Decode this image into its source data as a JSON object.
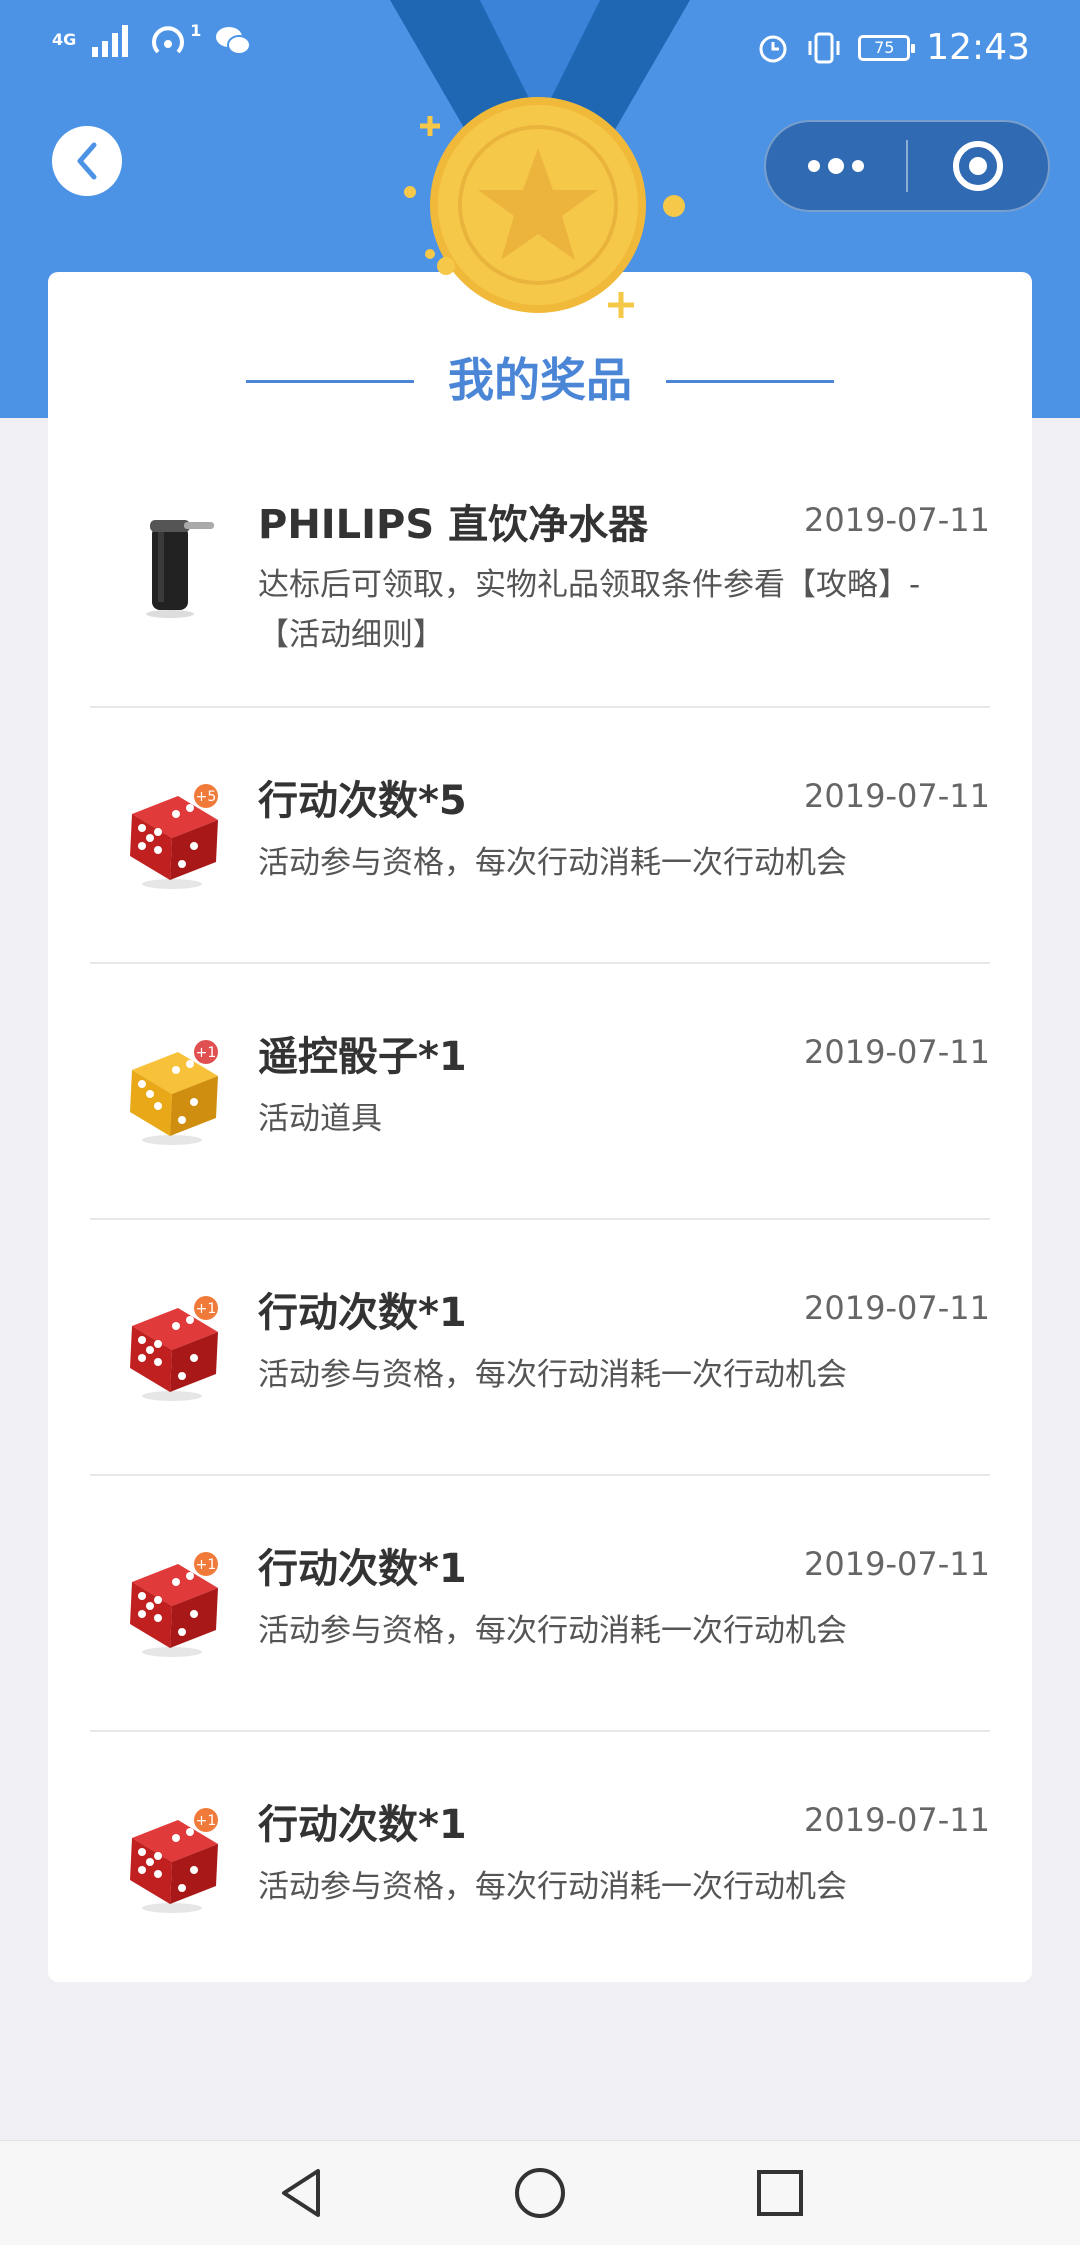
{
  "status_bar": {
    "network": "4G",
    "signal_sub": "1",
    "battery": "75",
    "time": "12:43"
  },
  "page": {
    "title": "我的奖品"
  },
  "colors": {
    "header_blue": "#4c93e6",
    "ribbon_blue": "#1f66b3",
    "title_blue": "#4a85d6",
    "medal_gold": "#f6c84a",
    "background": "#efeff4"
  },
  "prizes": [
    {
      "icon": "water-purifier-icon",
      "name": "PHILIPS 直饮净水器",
      "date": "2019-07-11",
      "desc": "达标后可领取，实物礼品领取条件参看【攻略】-【活动细则】"
    },
    {
      "icon": "red-dice-icon",
      "badge": "+5",
      "name": "行动次数*5",
      "date": "2019-07-11",
      "desc": "活动参与资格，每次行动消耗一次行动机会"
    },
    {
      "icon": "yellow-dice-icon",
      "badge": "+1",
      "name": "遥控骰子*1",
      "date": "2019-07-11",
      "desc": "活动道具"
    },
    {
      "icon": "red-dice-icon",
      "badge": "+1",
      "name": "行动次数*1",
      "date": "2019-07-11",
      "desc": "活动参与资格，每次行动消耗一次行动机会"
    },
    {
      "icon": "red-dice-icon",
      "badge": "+1",
      "name": "行动次数*1",
      "date": "2019-07-11",
      "desc": "活动参与资格，每次行动消耗一次行动机会"
    },
    {
      "icon": "red-dice-icon",
      "badge": "+1",
      "name": "行动次数*1",
      "date": "2019-07-11",
      "desc": "活动参与资格，每次行动消耗一次行动机会"
    }
  ]
}
